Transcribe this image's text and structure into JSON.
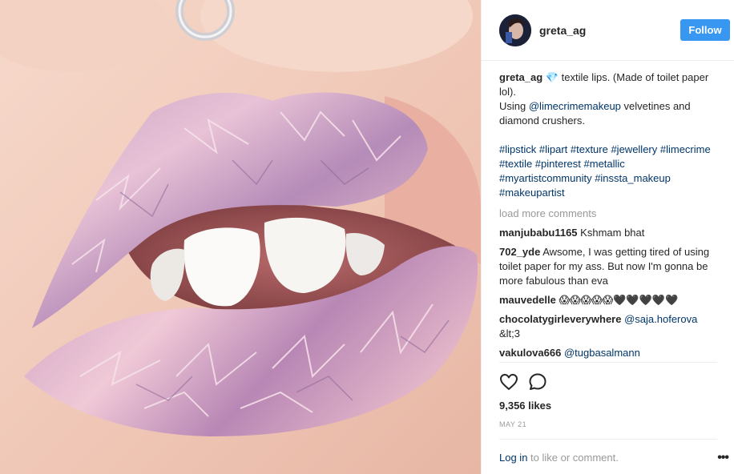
{
  "post": {
    "username": "greta_ag",
    "follow_label": "Follow"
  },
  "caption": {
    "username": "greta_ag",
    "gem": "💎",
    "text1": " textile lips. (Made of toilet paper lol).",
    "text2_pre": "Using ",
    "mention": "@limecrimemakeup",
    "text2_post": " velvetines and diamond crushers.",
    "hashtags": "#lipstick #lipart #texture #jewellery #limecrime #textile #pinterest #metallic #myartistcommunity #inssta_makeup #makeupartist"
  },
  "load_more": "load more comments",
  "comments": [
    {
      "user": "manjubabu1165",
      "text": "Kshmam bhat",
      "mention": ""
    },
    {
      "user": "702_yde",
      "text": "Awsome, I was getting tired of using toilet paper for my ass. But now I'm gonna be more fabulous than eva",
      "mention": ""
    },
    {
      "user": "mauvedelle",
      "text": "😱😱😱😱😱🖤🖤🖤🖤🖤",
      "mention": ""
    },
    {
      "user": "chocolatygirleverywhere",
      "text": " &lt;3",
      "mention": "@saja.hoferova"
    },
    {
      "user": "vakulova666",
      "text": "",
      "mention": "@tugbasalmann"
    }
  ],
  "likes": "9,356 likes",
  "date": "MAY 21",
  "footer": {
    "login_link": "Log in",
    "login_text": " to like or comment."
  },
  "icons": {
    "like": "heart-icon",
    "comment": "speech-bubble-icon",
    "more": "more-options-icon"
  },
  "colors": {
    "follow_bg": "#3897f0",
    "link": "#003569",
    "muted": "#999999",
    "border": "#efefef"
  }
}
